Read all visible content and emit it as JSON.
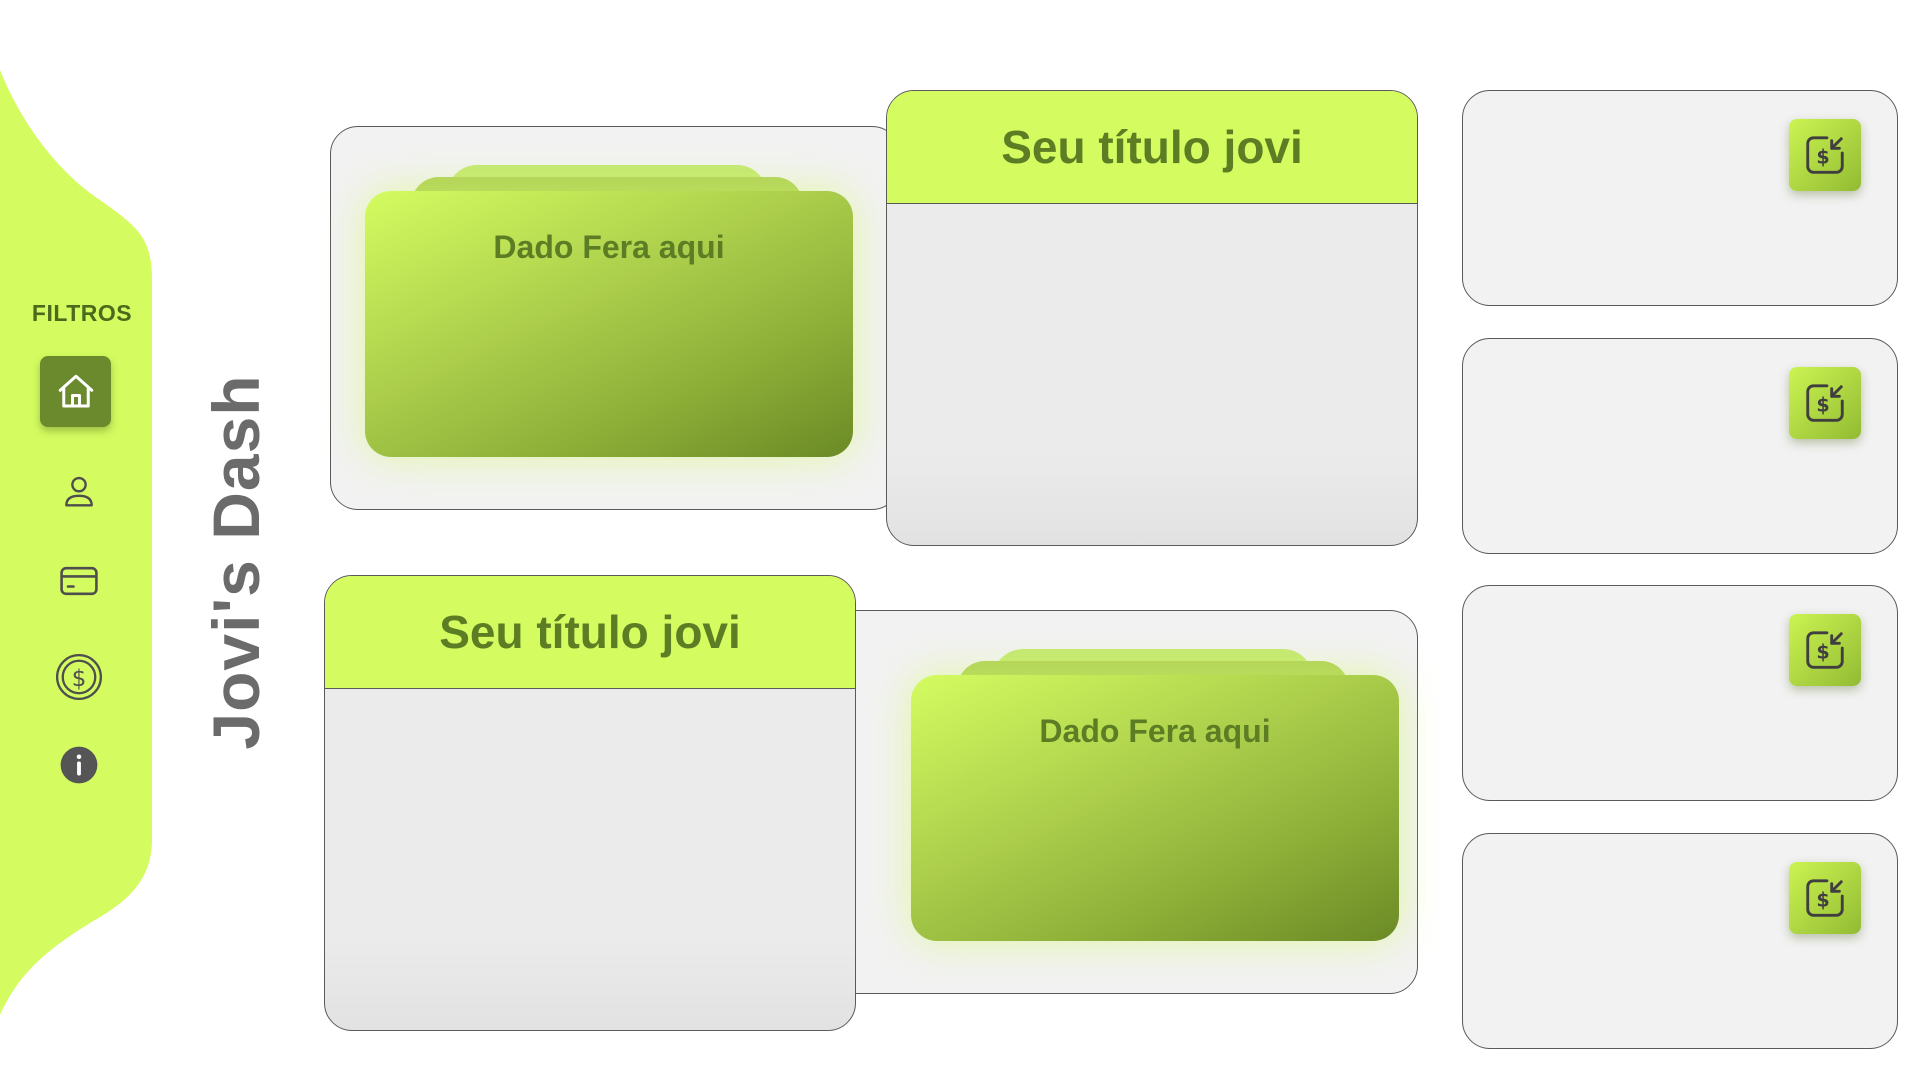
{
  "sidebar": {
    "filter_label": "FILTROS",
    "items": [
      {
        "icon": "home-icon",
        "active": true
      },
      {
        "icon": "user-icon",
        "active": false
      },
      {
        "icon": "card-icon",
        "active": false
      },
      {
        "icon": "dollar-coin-icon",
        "active": false
      },
      {
        "icon": "info-icon",
        "active": false
      }
    ]
  },
  "brand": {
    "title": "Jovi's Dash"
  },
  "panels": {
    "top_left": {
      "data_label": "Dado Fera aqui"
    },
    "top_right": {
      "title": "Seu título jovi"
    },
    "bottom_left": {
      "title": "Seu título jovi"
    },
    "bottom_right": {
      "data_label": "Dado Fera aqui"
    }
  },
  "side_cards": [
    {
      "icon": "money-exchange-icon"
    },
    {
      "icon": "money-exchange-icon"
    },
    {
      "icon": "money-exchange-icon"
    },
    {
      "icon": "money-exchange-icon"
    }
  ],
  "colors": {
    "accent": "#d4fc60",
    "accent_dark": "#6b8a2e",
    "text_green": "#5c7d24",
    "brand_gray": "#6b6b6b",
    "panel_bg": "#f2f2f2"
  }
}
